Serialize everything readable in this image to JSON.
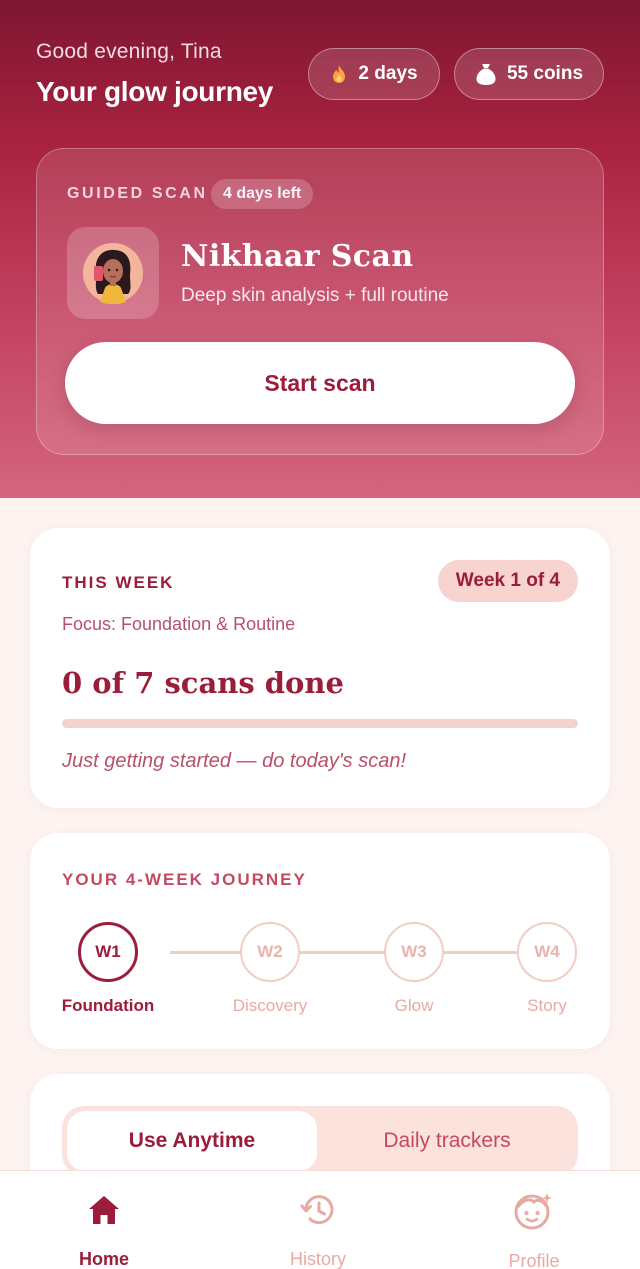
{
  "header": {
    "greeting": "Good evening, Tina",
    "title": "Your glow journey",
    "streak_label": "2 days",
    "coins_label": "55 coins"
  },
  "scan_card": {
    "kicker": "GUIDED SCAN",
    "days_left": "4 days left",
    "name": "Nikhaar Scan",
    "subtitle": "Deep skin analysis + full routine",
    "cta": "Start scan"
  },
  "week_card": {
    "kicker": "THIS WEEK",
    "badge": "Week 1 of 4",
    "focus": "Focus: Foundation & Routine",
    "progress_text": "0 of 7 scans done",
    "progress_fraction": 0,
    "note": "Just getting started — do today's scan!"
  },
  "journey": {
    "kicker": "YOUR 4-WEEK JOURNEY",
    "steps": [
      {
        "code": "W1",
        "label": "Foundation",
        "active": true
      },
      {
        "code": "W2",
        "label": "Discovery",
        "active": false
      },
      {
        "code": "W3",
        "label": "Glow",
        "active": false
      },
      {
        "code": "W4",
        "label": "Story",
        "active": false
      }
    ]
  },
  "tabs": {
    "selected": "Use Anytime",
    "other": "Daily trackers"
  },
  "bottom_nav": {
    "home": "Home",
    "history": "History",
    "profile": "Profile"
  },
  "colors": {
    "brand": "#9b1c3b",
    "hero_top": "#7d1631",
    "hero_bottom": "#d4657d",
    "page_bg": "#fdf3f1",
    "muted": "#e7aaa2",
    "flame": "#ffa53a"
  },
  "icons": {
    "streak": "flame-icon",
    "coins": "coin-bag-icon",
    "home": "home-icon",
    "history": "history-icon",
    "profile": "profile-icon"
  }
}
